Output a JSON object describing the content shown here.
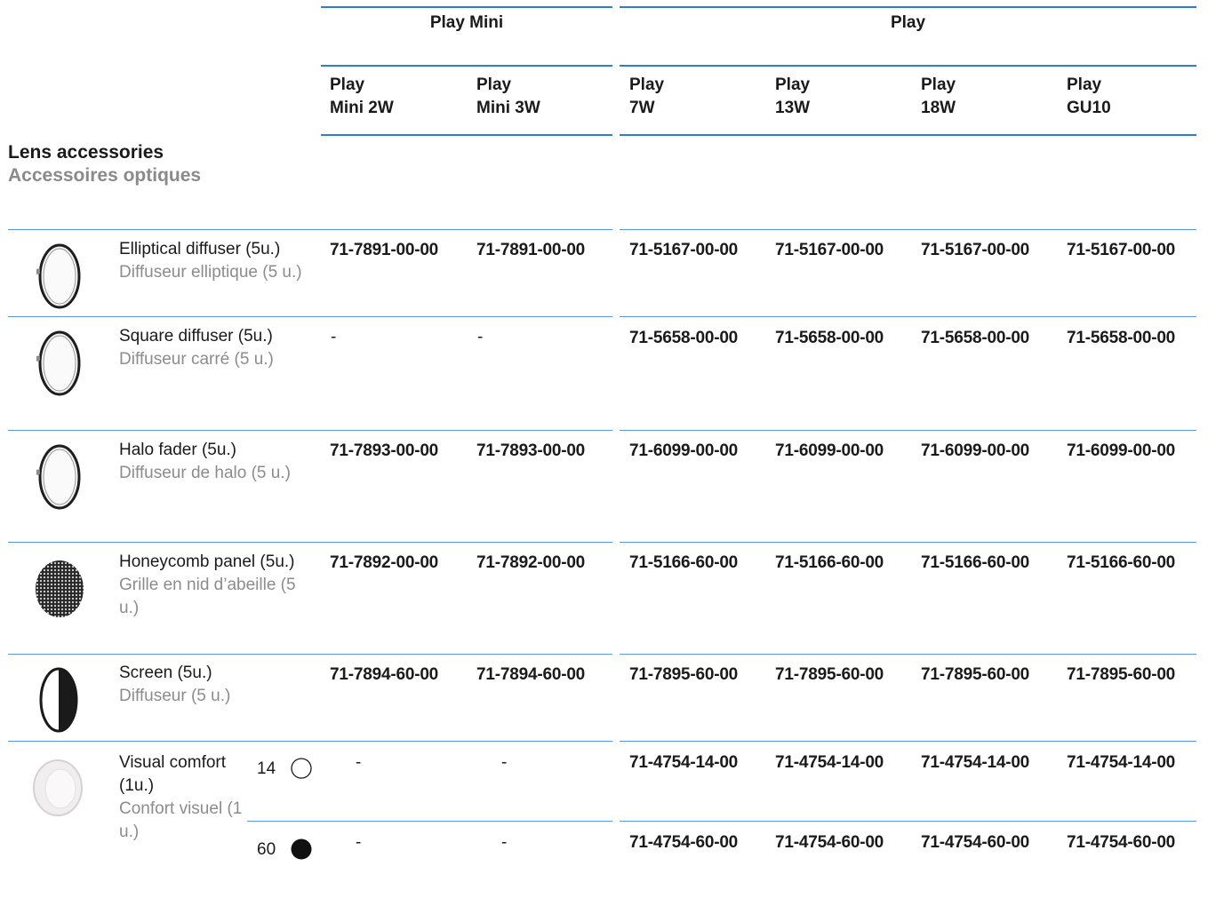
{
  "groups": {
    "play_mini": "Play Mini",
    "play": "Play"
  },
  "columns": [
    "Play\nMini 2W",
    "Play\nMini 3W",
    "Play\n7W",
    "Play\n13W",
    "Play\n18W",
    "Play\nGU10"
  ],
  "section": {
    "title_en": "Lens accessories",
    "title_fr": "Accessoires optiques"
  },
  "rows": [
    {
      "icon": "elliptical-diffuser-icon",
      "name_en": "Elliptical diffuser (5u.)",
      "name_fr": "Diffuseur elliptique (5 u.)",
      "codes": [
        "71-7891-00-00",
        "71-7891-00-00",
        "71-5167-00-00",
        "71-5167-00-00",
        "71-5167-00-00",
        "71-5167-00-00"
      ]
    },
    {
      "icon": "square-diffuser-icon",
      "name_en": "Square diffuser (5u.)",
      "name_fr": "Diffuseur carré (5 u.)",
      "codes": [
        "-",
        "-",
        "71-5658-00-00",
        "71-5658-00-00",
        "71-5658-00-00",
        "71-5658-00-00"
      ]
    },
    {
      "icon": "halo-fader-icon",
      "name_en": "Halo fader (5u.)",
      "name_fr": "Diffuseur de halo (5 u.)",
      "codes": [
        "71-7893-00-00",
        "71-7893-00-00",
        "71-6099-00-00",
        "71-6099-00-00",
        "71-6099-00-00",
        "71-6099-00-00"
      ]
    },
    {
      "icon": "honeycomb-panel-icon",
      "name_en": "Honeycomb panel (5u.)",
      "name_fr": "Grille en nid d’abeille (5 u.)",
      "codes": [
        "71-7892-00-00",
        "71-7892-00-00",
        "71-5166-60-00",
        "71-5166-60-00",
        "71-5166-60-00",
        "71-5166-60-00"
      ]
    },
    {
      "icon": "screen-icon",
      "name_en": "Screen (5u.)",
      "name_fr": "Diffuseur (5 u.)",
      "codes": [
        "71-7894-60-00",
        "71-7894-60-00",
        "71-7895-60-00",
        "71-7895-60-00",
        "71-7895-60-00",
        "71-7895-60-00"
      ]
    },
    {
      "icon": "visual-comfort-icon",
      "name_en": "Visual comfort (1u.)",
      "name_fr": "Confort visuel (1 u.)",
      "variants": [
        {
          "label": "14",
          "swatch": "white-circle-icon",
          "codes": [
            "-",
            "-",
            "71-4754-14-00",
            "71-4754-14-00",
            "71-4754-14-00",
            "71-4754-14-00"
          ]
        },
        {
          "label": "60",
          "swatch": "black-circle-icon",
          "codes": [
            "-",
            "-",
            "71-4754-60-00",
            "71-4754-60-00",
            "71-4754-60-00",
            "71-4754-60-00"
          ]
        }
      ]
    }
  ],
  "colors": {
    "rule": "#2e7ec9",
    "text": "#1a1a1a",
    "secondary_text": "#8c8c8c"
  }
}
